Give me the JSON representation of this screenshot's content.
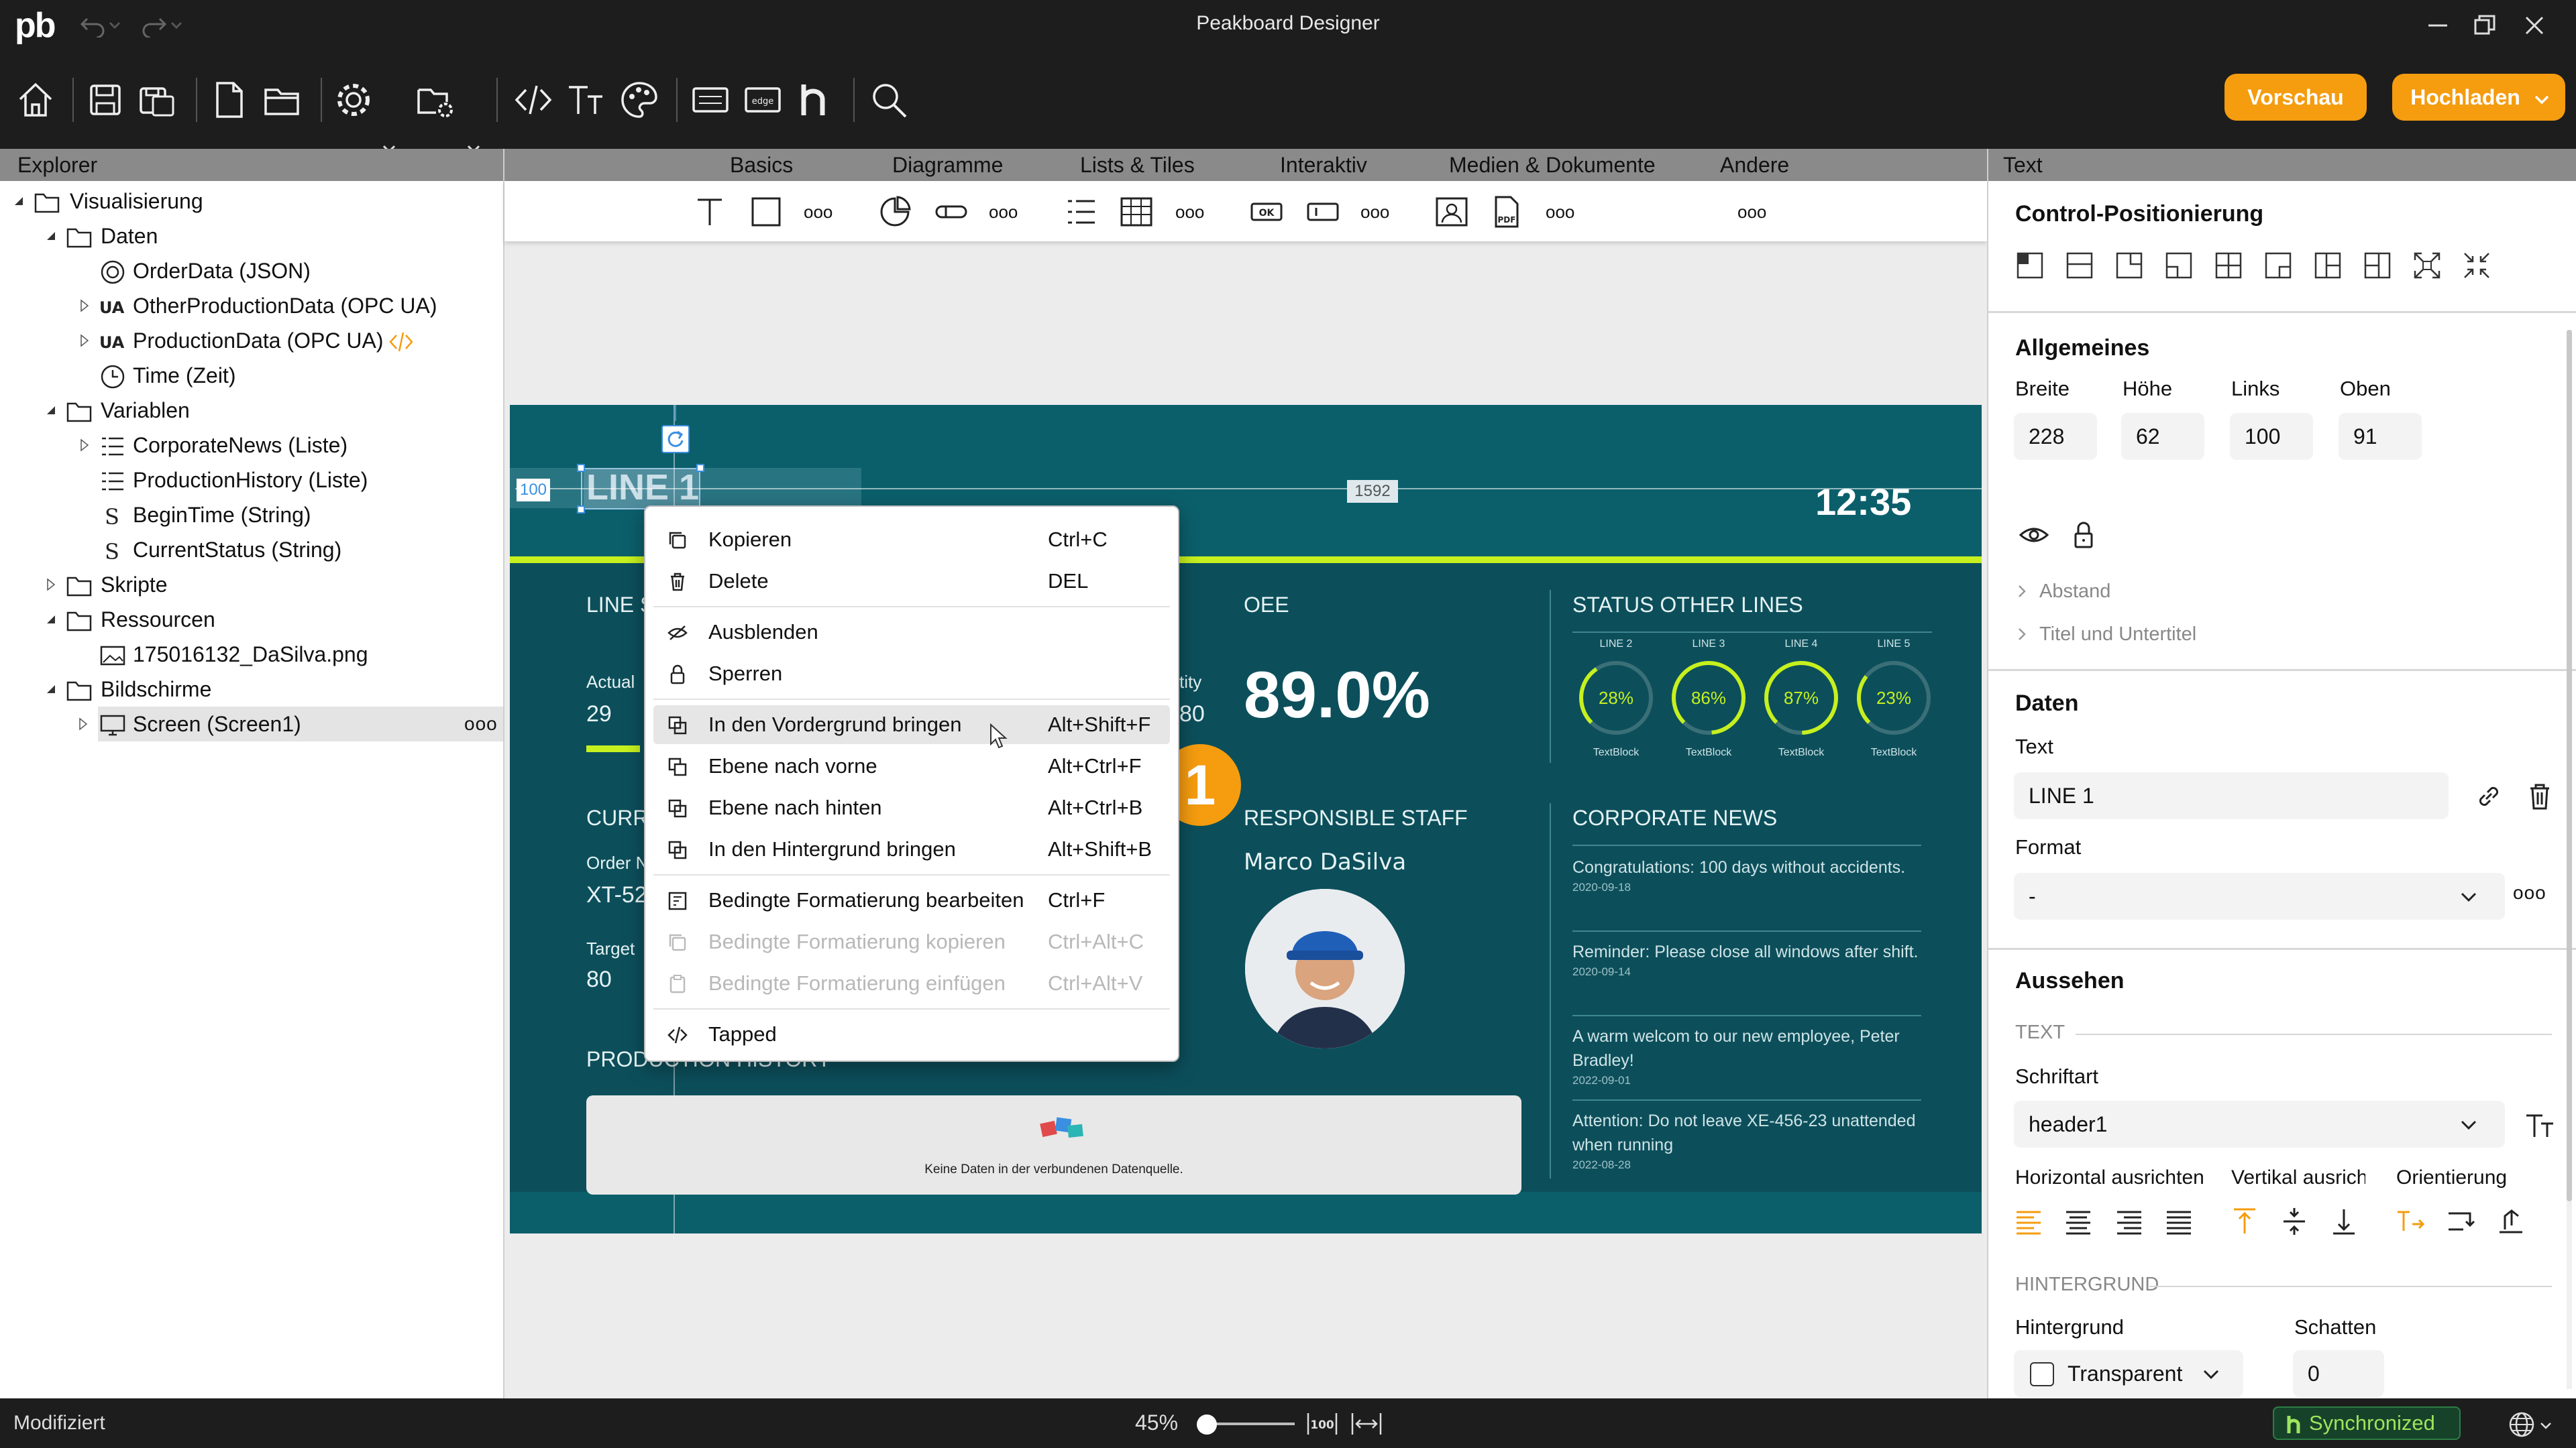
{
  "window": {
    "app_logo": "pb",
    "title": "Peakboard Designer"
  },
  "toolbar": {
    "preview_label": "Vorschau",
    "upload_label": "Hochladen"
  },
  "explorer": {
    "header": "Explorer",
    "items": [
      {
        "label": "Visualisierung"
      },
      {
        "label": "Daten"
      },
      {
        "label": "OrderData (JSON)"
      },
      {
        "label": "OtherProductionData (OPC UA)"
      },
      {
        "label": "ProductionData (OPC UA)"
      },
      {
        "label": "Time (Zeit)"
      },
      {
        "label": "Variablen"
      },
      {
        "label": "CorporateNews (Liste)"
      },
      {
        "label": "ProductionHistory (Liste)"
      },
      {
        "label": "BeginTime (String)"
      },
      {
        "label": "CurrentStatus (String)"
      },
      {
        "label": "Skripte"
      },
      {
        "label": "Ressourcen"
      },
      {
        "label": "175016132_DaSilva.png"
      },
      {
        "label": "Bildschirme"
      },
      {
        "label": "Screen (Screen1)"
      }
    ],
    "more": "ooo"
  },
  "center": {
    "tabs": [
      "Basics",
      "Diagramme",
      "Lists & Tiles",
      "Interaktiv",
      "Medien & Dokumente",
      "Andere"
    ],
    "more": "ooo"
  },
  "dashboard": {
    "selected_text": "LINE 1",
    "pos_left": "100",
    "pos_right": "1592",
    "clock": "12:35",
    "line_section": "LINE S",
    "actual_label": "Actual",
    "actual_value": "29",
    "quantity_label_partial": "tity",
    "quantity_value": "80",
    "oee_label": "OEE",
    "oee_value": "89.0%",
    "status_title": "STATUS OTHER LINES",
    "gauges": [
      {
        "line": "LINE 2",
        "value": "28%",
        "fraction": 0.28,
        "caption": "TextBlock"
      },
      {
        "line": "LINE 3",
        "value": "86%",
        "fraction": 0.86,
        "caption": "TextBlock"
      },
      {
        "line": "LINE 4",
        "value": "87%",
        "fraction": 0.87,
        "caption": "TextBlock"
      },
      {
        "line": "LINE 5",
        "value": "23%",
        "fraction": 0.23,
        "caption": "TextBlock"
      }
    ],
    "current_label": "CURR",
    "order_label": "Order N",
    "order_value": "XT-52",
    "target_label": "Target",
    "target_value": "80",
    "staff_title": "RESPONSIBLE STAFF",
    "staff_name": "Marco DaSilva",
    "news_title": "CORPORATE NEWS",
    "news": [
      {
        "text": "Congratulations: 100 days without accidents.",
        "date": "2020-09-18"
      },
      {
        "text": "Reminder: Please close all windows after shift.",
        "date": "2020-09-14"
      },
      {
        "text": "A warm welcom to our new employee, Peter Bradley!",
        "date": "2022-09-01"
      },
      {
        "text": "Attention: Do not leave XE-456-23 unattended when running",
        "date": "2022-08-28"
      }
    ],
    "history_title": "PRODUCTION HISTORY",
    "history_empty": "Keine Daten in der verbundenen Datenquelle.",
    "step_badge": "1"
  },
  "context_menu": {
    "items": [
      {
        "label": "Kopieren",
        "shortcut": "Ctrl+C"
      },
      {
        "label": "Delete",
        "shortcut": "DEL"
      },
      {
        "label": "Ausblenden",
        "shortcut": ""
      },
      {
        "label": "Sperren",
        "shortcut": ""
      },
      {
        "label": "In den Vordergrund bringen",
        "shortcut": "Alt+Shift+F"
      },
      {
        "label": "Ebene nach vorne",
        "shortcut": "Alt+Ctrl+F"
      },
      {
        "label": "Ebene nach hinten",
        "shortcut": "Alt+Ctrl+B"
      },
      {
        "label": "In den Hintergrund bringen",
        "shortcut": "Alt+Shift+B"
      },
      {
        "label": "Bedingte Formatierung bearbeiten",
        "shortcut": "Ctrl+F"
      },
      {
        "label": "Bedingte Formatierung kopieren",
        "shortcut": "Ctrl+Alt+C"
      },
      {
        "label": "Bedingte Formatierung einfügen",
        "shortcut": "Ctrl+Alt+V"
      },
      {
        "label": "Tapped",
        "shortcut": ""
      }
    ]
  },
  "properties": {
    "header": "Text",
    "control_positioning": "Control-Positionierung",
    "general_title": "Allgemeines",
    "width_label": "Breite",
    "width_value": "228",
    "height_label": "Höhe",
    "height_value": "62",
    "left_label": "Links",
    "left_value": "100",
    "top_label": "Oben",
    "top_value": "91",
    "spacing_label": "Abstand",
    "title_subtitle_label": "Titel und Untertitel",
    "data_title": "Daten",
    "text_label": "Text",
    "text_value": "LINE 1",
    "format_label": "Format",
    "format_value": "-",
    "appearance_title": "Aussehen",
    "text_section": "TEXT",
    "font_label": "Schriftart",
    "font_value": "header1",
    "h_align_label": "Horizontal ausrichten",
    "v_align_label": "Vertikal ausricht",
    "orientation_label": "Orientierung",
    "bg_section": "HINTERGRUND",
    "bg_label": "Hintergrund",
    "shadow_label": "Schatten",
    "bg_value": "Transparent",
    "shadow_value": "0",
    "more": "ooo"
  },
  "status": {
    "left": "Modifiziert",
    "zoom": "45%",
    "sync": "Synchronized"
  },
  "colors": {
    "accent": "#f59c0f",
    "dashboard_bg": "#0b5f6b",
    "dashboard_dark": "#0c4f5b",
    "lime": "#c6f01e"
  }
}
